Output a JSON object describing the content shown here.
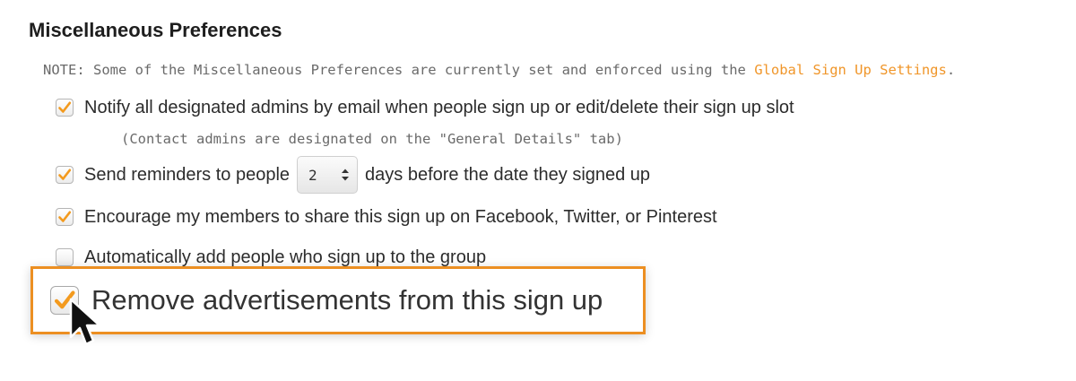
{
  "section": {
    "title": "Miscellaneous Preferences",
    "note_prefix": "NOTE: Some of the Miscellaneous Preferences are currently set and enforced using the ",
    "note_link": "Global Sign Up Settings",
    "note_suffix": "."
  },
  "options": {
    "notify_admins": {
      "label": "Notify all designated admins by email when people sign up or edit/delete their sign up slot",
      "checked": true
    },
    "notify_hint": "(Contact admins are designated on the \"General Details\" tab)",
    "reminders": {
      "label_before": "Send reminders to people",
      "days_value": "2",
      "label_after": "days before the date they signed up",
      "checked": true
    },
    "share_social": {
      "label": "Encourage my members to share this sign up on Facebook, Twitter, or Pinterest",
      "checked": true
    },
    "add_to_group": {
      "label": "Automatically add people who sign up to the group",
      "checked": false
    }
  },
  "callout": {
    "label": "Remove advertisements from this sign up",
    "checked": true
  },
  "colors": {
    "accent": "#ec8f22",
    "link": "#f0962a",
    "checkmark": "#f39a1e"
  },
  "icons": {
    "checkbox_mark": "check-icon",
    "select_arrows": "updown-arrow-icon",
    "pointer": "mouse-cursor-icon"
  }
}
